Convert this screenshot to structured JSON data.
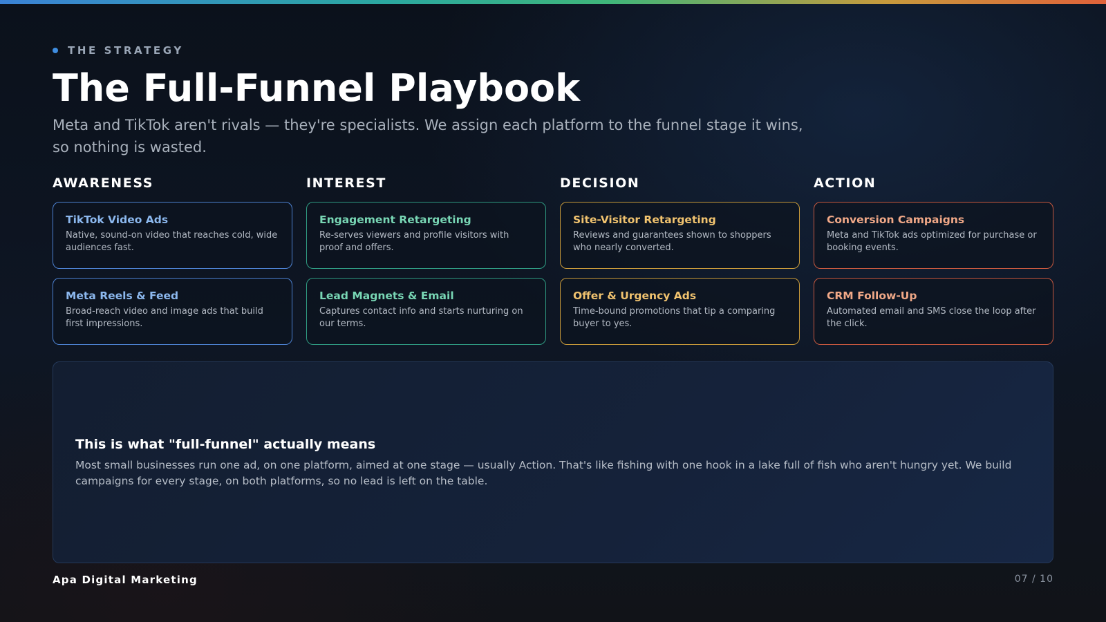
{
  "eyebrow": "THE STRATEGY",
  "title": "The Full-Funnel Playbook",
  "subtitle": "Meta and TikTok aren't rivals — they're specialists. We assign each platform to the funnel stage it wins, so nothing is wasted.",
  "stages": [
    {
      "name": "AWARENESS",
      "accent": "#4d82d2",
      "cards": [
        {
          "title": "TikTok Video Ads",
          "desc": "Native, sound-on video that reaches cold, wide audiences fast."
        },
        {
          "title": "Meta Reels & Feed",
          "desc": "Broad-reach video and image ads that build first impressions."
        }
      ]
    },
    {
      "name": "INTEREST",
      "accent": "#2f9b82",
      "cards": [
        {
          "title": "Engagement Retargeting",
          "desc": "Re-serves viewers and profile visitors with proof and offers."
        },
        {
          "title": "Lead Magnets & Email",
          "desc": "Captures contact info and starts nurturing on our terms."
        }
      ]
    },
    {
      "name": "DECISION",
      "accent": "#c89a3a",
      "cards": [
        {
          "title": "Site-Visitor Retargeting",
          "desc": "Reviews and guarantees shown to shoppers who nearly converted."
        },
        {
          "title": "Offer & Urgency Ads",
          "desc": "Time-bound promotions that tip a comparing buyer to yes."
        }
      ]
    },
    {
      "name": "ACTION",
      "accent": "#c7583f",
      "cards": [
        {
          "title": "Conversion Campaigns",
          "desc": "Meta and TikTok ads optimized for purchase or booking events."
        },
        {
          "title": "CRM Follow-Up",
          "desc": "Automated email and SMS close the loop after the click."
        }
      ]
    }
  ],
  "callout": {
    "title": "This is what \"full-funnel\" actually means",
    "body": "Most small businesses run one ad, on one platform, aimed at one stage — usually Action. That's like fishing with one hook in a lake full of fish who aren't hungry yet. We build campaigns for every stage, on both platforms, so no lead is left on the table."
  },
  "footer": {
    "brand": "Apa Digital Marketing",
    "page": "07 / 10"
  }
}
